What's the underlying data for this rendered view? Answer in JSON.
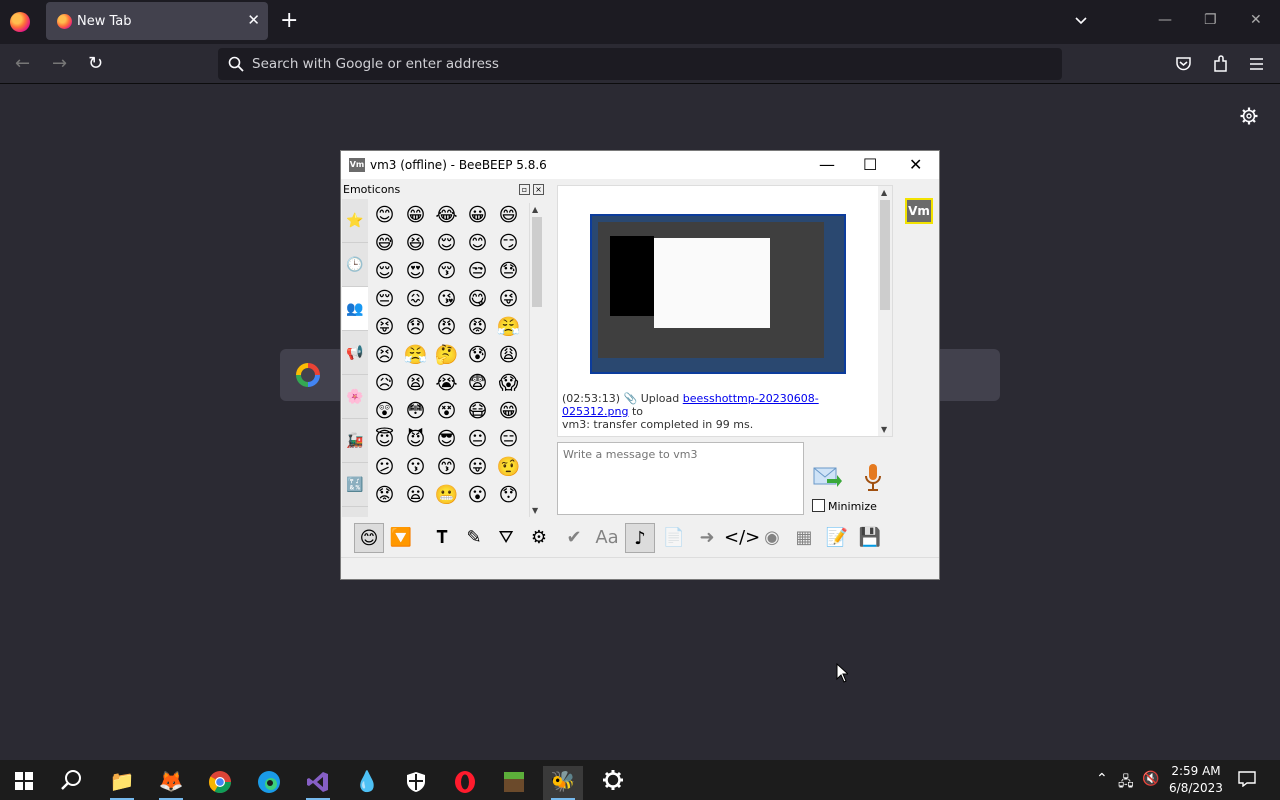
{
  "browser": {
    "tab": {
      "title": "New Tab",
      "close_glyph": "✕"
    },
    "new_tab_glyph": "+",
    "window_controls": {
      "minimize": "—",
      "restore": "❐",
      "close": "✕"
    },
    "nav": {
      "back": "←",
      "forward": "→",
      "reload": "↻"
    },
    "urlbar": {
      "placeholder": "Search with Google or enter address"
    },
    "toolbar_icons": [
      "pocket-icon",
      "extensions-icon",
      "menu-icon"
    ]
  },
  "beebeep": {
    "title": "vm3 (offline) - BeeBEEP 5.8.6",
    "app_icon_text": "Vm",
    "window_controls": {
      "minimize": "—",
      "maximize": "☐",
      "close": "✕"
    },
    "emoticons": {
      "header": "Emoticons",
      "tabs": [
        "⭐",
        "🕒",
        "👥",
        "📢",
        "🌸",
        "🚂",
        "🔣"
      ],
      "active_tab": 2,
      "grid": [
        "😊",
        "😁",
        "😂",
        "😀",
        "😄",
        "😅",
        "😆",
        "😌",
        "😊",
        "😏",
        "😌",
        "😍",
        "😚",
        "😒",
        "😓",
        "😔",
        "😖",
        "😘",
        "😋",
        "😜",
        "😝",
        "😞",
        "😠",
        "😡",
        "😤",
        "😣",
        "😤",
        "🤔",
        "😰",
        "😩",
        "😥",
        "😫",
        "😭",
        "😨",
        "😱",
        "😲",
        "😳",
        "😵",
        "😷",
        "😁",
        "😇",
        "😈",
        "😎",
        "😐",
        "😑",
        "😕",
        "😗",
        "😙",
        "😛",
        "🤨",
        "😟",
        "😦",
        "😬",
        "😮",
        "😯"
      ]
    },
    "chat": {
      "timestamp": "(02:53:13)",
      "upload_word": "Upload",
      "file_link": "beesshottmp-20230608-025312.png",
      "to_word": "to",
      "status_line": "vm3: transfer completed in 99 ms."
    },
    "message_input": {
      "placeholder": "Write a message to vm3"
    },
    "minimize_label": "Minimize",
    "avatar_text": "Vm",
    "toolbar": [
      "😊",
      "🔽",
      "𝐓",
      "✎",
      "⛛",
      "⚙",
      "✔",
      "Aa",
      "♪",
      "📄",
      "➜",
      "</>",
      "◉",
      "▦",
      "📝",
      "💾"
    ]
  },
  "taskbar": {
    "apps": [
      "windows-start",
      "search",
      "file-explorer",
      "firefox",
      "chrome",
      "edge",
      "visual-studio",
      "app-drop",
      "defender",
      "opera",
      "minecraft",
      "beebeep",
      "settings"
    ],
    "clock_time": "2:59 AM",
    "clock_date": "6/8/2023"
  },
  "colors": {
    "browser_bg": "#2b2a33",
    "tabstrip": "#1c1b22",
    "taskbar": "#1c1c1c",
    "avatar_border": "#f2e200",
    "link": "#0000ee"
  }
}
